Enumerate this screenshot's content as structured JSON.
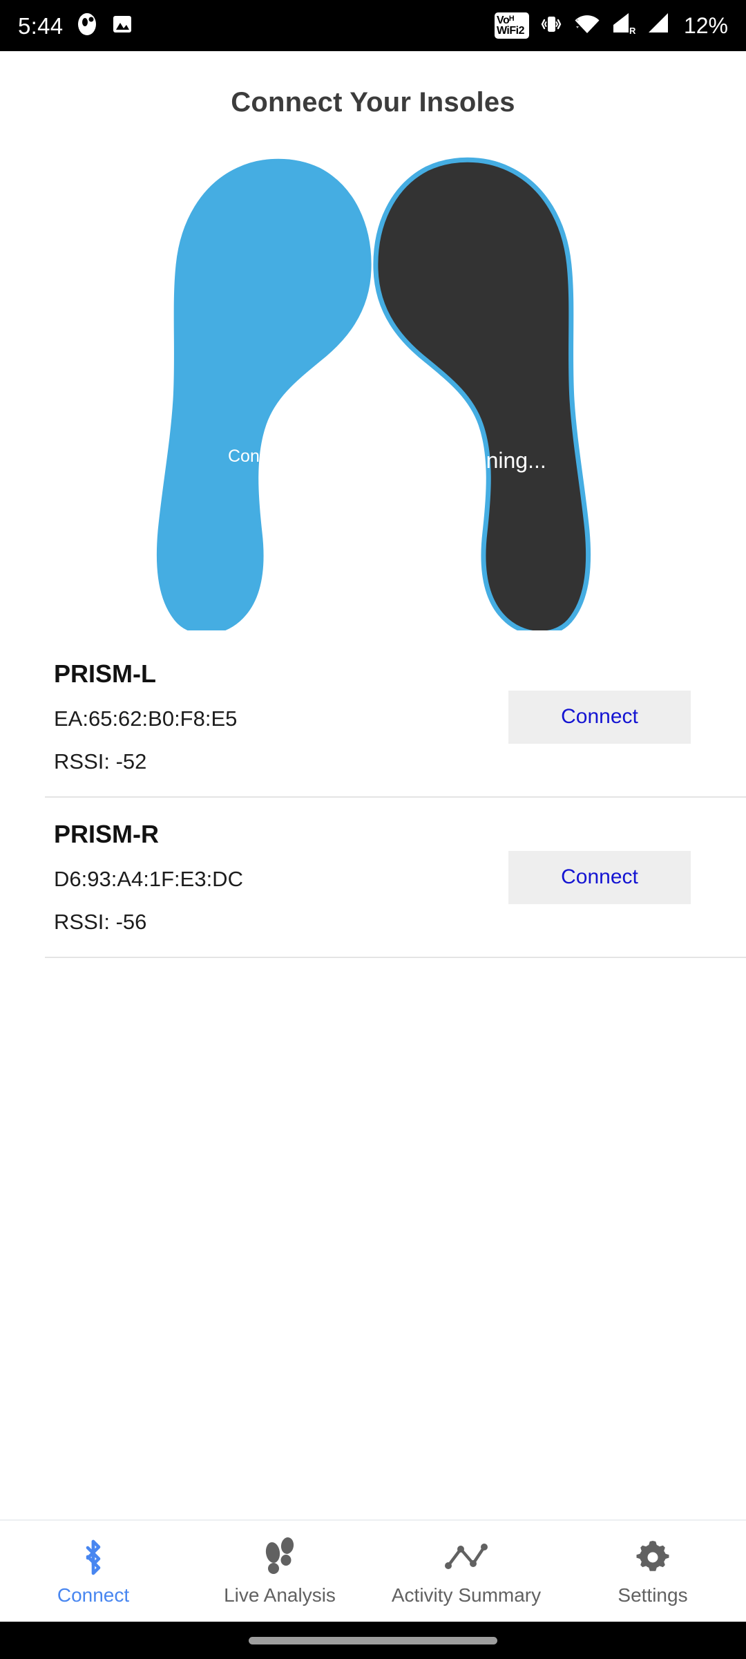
{
  "status_bar": {
    "time": "5:44",
    "battery": "12%",
    "icons_left": [
      "notification-dot-icon",
      "image-icon"
    ],
    "icons_right": [
      "vowifi2-icon",
      "vibrate-icon",
      "wifi-icon",
      "signal-roaming-icon",
      "signal-icon"
    ],
    "vowifi_line1": "Voᴴ",
    "vowifi_line2": "WiFi2"
  },
  "app_bar": {
    "title": "Connect Your Insoles"
  },
  "insoles": {
    "left": {
      "status_label": "Connected",
      "fill_color": "#45ADE2",
      "stroke_color": "#45ADE2",
      "state": "connected"
    },
    "right": {
      "status_label": "Listening...",
      "fill_color": "#333333",
      "stroke_color": "#45ADE2",
      "state": "listening"
    }
  },
  "devices": [
    {
      "name": "PRISM-L",
      "mac": "EA:65:62:B0:F8:E5",
      "rssi": "RSSI: -52",
      "action_label": "Connect"
    },
    {
      "name": "PRISM-R",
      "mac": "D6:93:A4:1F:E3:DC",
      "rssi": "RSSI: -56",
      "action_label": "Connect"
    }
  ],
  "bottom_nav": {
    "active_index": 0,
    "active_color": "#4886F0",
    "inactive_color": "#616161",
    "items": [
      {
        "label": "Connect",
        "icon": "bluetooth-icon"
      },
      {
        "label": "Live Analysis",
        "icon": "footsteps-icon"
      },
      {
        "label": "Activity Summary",
        "icon": "line-chart-icon"
      },
      {
        "label": "Settings",
        "icon": "gear-icon"
      }
    ]
  }
}
